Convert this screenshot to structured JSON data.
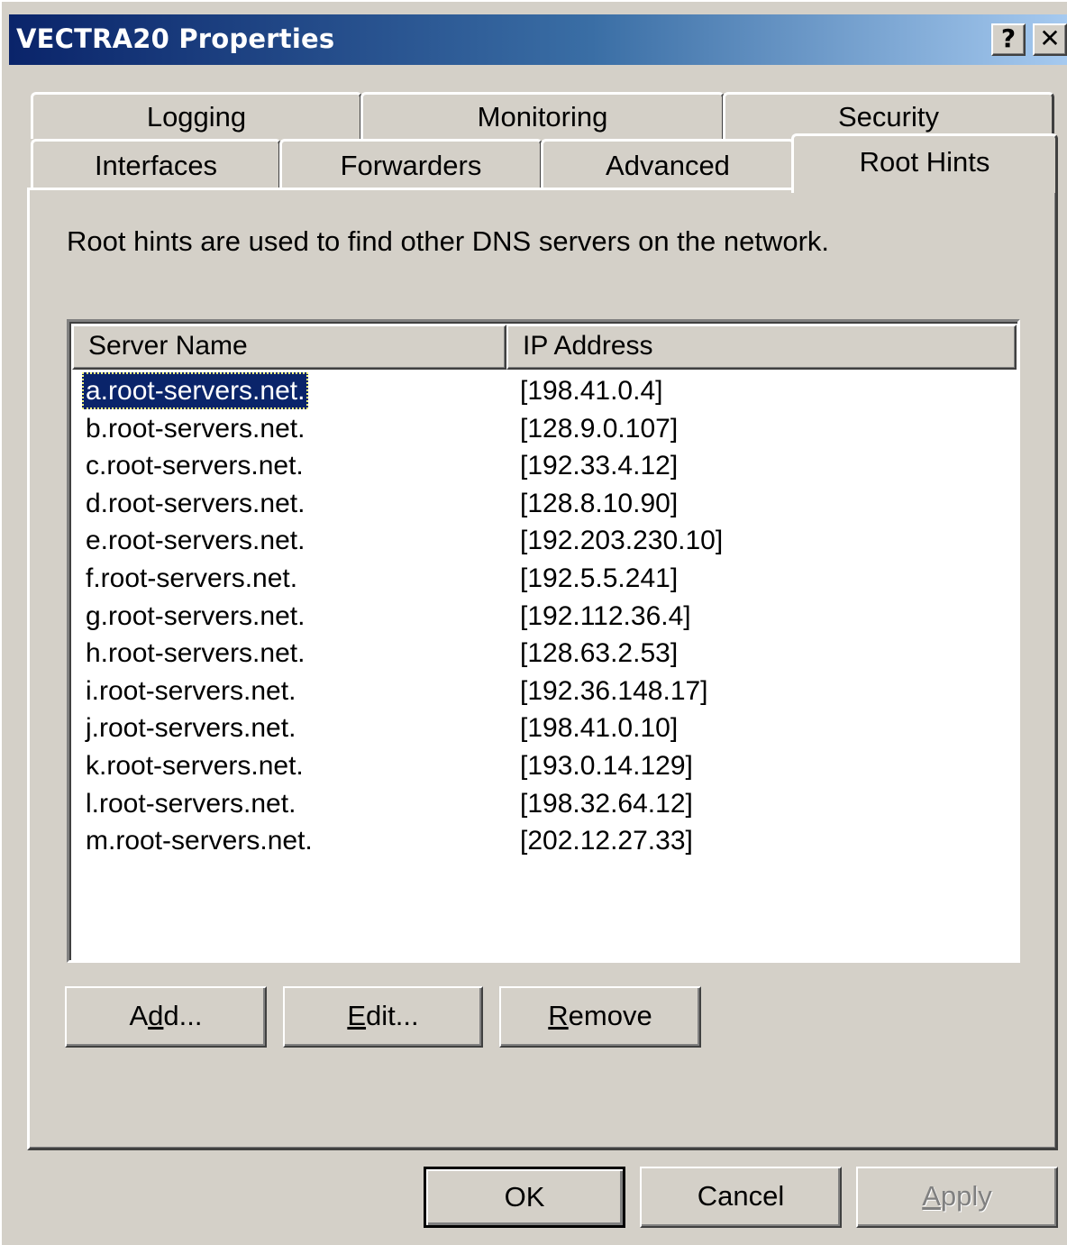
{
  "window": {
    "title": "VECTRA20 Properties",
    "help_glyph": "?",
    "close_glyph": "✕"
  },
  "tabs": {
    "row_back": [
      {
        "label": "Logging"
      },
      {
        "label": "Monitoring"
      },
      {
        "label": "Security"
      }
    ],
    "row_front": [
      {
        "label": "Interfaces"
      },
      {
        "label": "Forwarders"
      },
      {
        "label": "Advanced"
      },
      {
        "label": "Root Hints",
        "active": true
      }
    ]
  },
  "panel": {
    "description": "Root hints are used to find other DNS servers on the network."
  },
  "list": {
    "columns": {
      "name": "Server Name",
      "ip": "IP Address"
    },
    "selected_index": 0,
    "rows": [
      {
        "name": "a.root-servers.net.",
        "ip": "[198.41.0.4]"
      },
      {
        "name": "b.root-servers.net.",
        "ip": "[128.9.0.107]"
      },
      {
        "name": "c.root-servers.net.",
        "ip": "[192.33.4.12]"
      },
      {
        "name": "d.root-servers.net.",
        "ip": "[128.8.10.90]"
      },
      {
        "name": "e.root-servers.net.",
        "ip": "[192.203.230.10]"
      },
      {
        "name": "f.root-servers.net.",
        "ip": "[192.5.5.241]"
      },
      {
        "name": "g.root-servers.net.",
        "ip": "[192.112.36.4]"
      },
      {
        "name": "h.root-servers.net.",
        "ip": "[128.63.2.53]"
      },
      {
        "name": "i.root-servers.net.",
        "ip": "[192.36.148.17]"
      },
      {
        "name": "j.root-servers.net.",
        "ip": "[198.41.0.10]"
      },
      {
        "name": "k.root-servers.net.",
        "ip": "[193.0.14.129]"
      },
      {
        "name": "l.root-servers.net.",
        "ip": "[198.32.64.12]"
      },
      {
        "name": "m.root-servers.net.",
        "ip": "[202.12.27.33]"
      }
    ]
  },
  "actions": {
    "add": {
      "pre": "A",
      "accel": "d",
      "post": "d..."
    },
    "edit": {
      "pre": "",
      "accel": "E",
      "post": "dit..."
    },
    "remove": {
      "pre": "",
      "accel": "R",
      "post": "emove"
    }
  },
  "footer": {
    "ok": "OK",
    "cancel": "Cancel",
    "apply": {
      "pre": "",
      "accel": "A",
      "post": "pply",
      "disabled": true
    }
  },
  "colors": {
    "face": "#d4d0c8",
    "titlebar_start": "#0a246a",
    "titlebar_end": "#a6caf0",
    "selection": "#0a246a",
    "disabled_text": "#808080"
  }
}
